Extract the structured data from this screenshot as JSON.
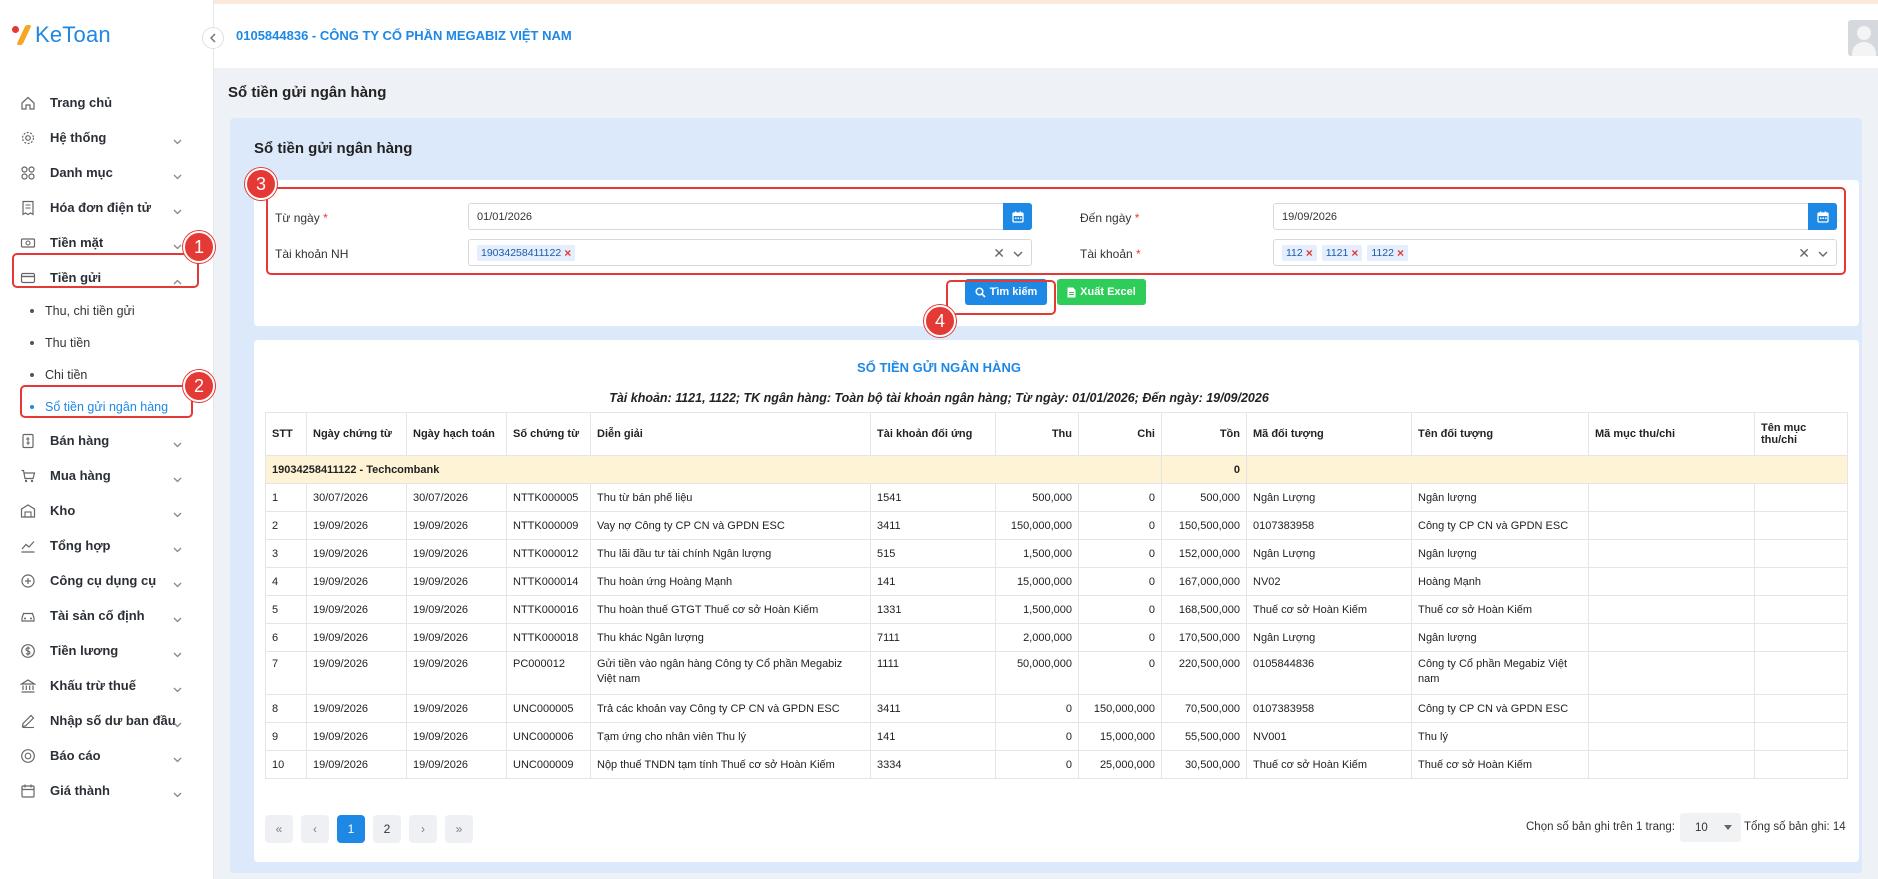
{
  "brand": {
    "logo_text": "KeToan"
  },
  "header": {
    "company": "0105844836 - CÔNG TY CỔ PHẦN MEGABIZ VIỆT NAM"
  },
  "sidebar": {
    "items": [
      {
        "label": "Trang chủ",
        "icon": "home-icon"
      },
      {
        "label": "Hệ thống",
        "icon": "gear-icon"
      },
      {
        "label": "Danh mục",
        "icon": "grid-icon"
      },
      {
        "label": "Hóa đơn điện tử",
        "icon": "invoice-icon"
      },
      {
        "label": "Tiền mặt",
        "icon": "cash-icon"
      },
      {
        "label": "Tiền gửi",
        "icon": "card-icon"
      },
      {
        "label": "Bán hàng",
        "icon": "sales-icon"
      },
      {
        "label": "Mua hàng",
        "icon": "cart-icon"
      },
      {
        "label": "Kho",
        "icon": "warehouse-icon"
      },
      {
        "label": "Tổng hợp",
        "icon": "chart-icon"
      },
      {
        "label": "Công cụ dụng cụ",
        "icon": "tools-icon"
      },
      {
        "label": "Tài sản cố định",
        "icon": "car-icon"
      },
      {
        "label": "Tiền lương",
        "icon": "dollar-icon"
      },
      {
        "label": "Khấu trừ thuế",
        "icon": "bank-icon"
      },
      {
        "label": "Nhập số dư ban đầu",
        "icon": "edit-icon"
      },
      {
        "label": "Báo cáo",
        "icon": "report-icon"
      },
      {
        "label": "Giá thành",
        "icon": "calendar-icon"
      }
    ],
    "sub_items": [
      {
        "label": "Thu, chi tiền gửi"
      },
      {
        "label": "Thu tiền"
      },
      {
        "label": "Chi tiền"
      },
      {
        "label": "Sổ tiền gửi ngân hàng"
      }
    ]
  },
  "page": {
    "title": "Sổ tiền gửi ngân hàng",
    "panel_title": "Sổ tiền gửi ngân hàng"
  },
  "filters": {
    "from_date_label": "Từ ngày",
    "from_date": "01/01/2026",
    "to_date_label": "Đến ngày",
    "to_date": "19/09/2026",
    "bank_account_label": "Tài khoản NH",
    "bank_account_tag": "19034258411122",
    "account_label": "Tài khoản",
    "account_tags": [
      "112",
      "1121",
      "1122"
    ],
    "required_mark": "*",
    "search_label": "Tìm kiếm",
    "excel_label": "Xuất Excel"
  },
  "report": {
    "title": "SỔ TIỀN GỬI NGÂN HÀNG",
    "subtitle": "Tài khoản: 1121, 1122; TK ngân hàng: Toàn bộ tài khoản ngân hàng; Từ ngày: 01/01/2026; Đến ngày: 19/09/2026"
  },
  "table": {
    "headers": [
      "STT",
      "Ngày chứng từ",
      "Ngày hạch toán",
      "Số chứng từ",
      "Diễn giải",
      "Tài khoản đối ứng",
      "Thu",
      "Chi",
      "Tồn",
      "Mã đối tượng",
      "Tên đối tượng",
      "Mã mục thu/chi",
      "Tên mục thu/chi"
    ],
    "group": {
      "label": "19034258411122 - Techcombank",
      "balance": "0"
    },
    "rows": [
      [
        "1",
        "30/07/2026",
        "30/07/2026",
        "NTTK000005",
        "Thu từ bán phế liệu",
        "1541",
        "500,000",
        "0",
        "500,000",
        "Ngân Lượng",
        "Ngân lượng",
        "",
        ""
      ],
      [
        "2",
        "19/09/2026",
        "19/09/2026",
        "NTTK000009",
        "Vay nợ Công ty CP CN và GPDN ESC",
        "3411",
        "150,000,000",
        "0",
        "150,500,000",
        "0107383958",
        "Công ty CP CN và GPDN ESC",
        "",
        ""
      ],
      [
        "3",
        "19/09/2026",
        "19/09/2026",
        "NTTK000012",
        "Thu lãi đầu tư tài chính Ngân lượng",
        "515",
        "1,500,000",
        "0",
        "152,000,000",
        "Ngân Lượng",
        "Ngân lượng",
        "",
        ""
      ],
      [
        "4",
        "19/09/2026",
        "19/09/2026",
        "NTTK000014",
        "Thu hoàn ứng Hoàng Mạnh",
        "141",
        "15,000,000",
        "0",
        "167,000,000",
        "NV02",
        "Hoàng Mạnh",
        "",
        ""
      ],
      [
        "5",
        "19/09/2026",
        "19/09/2026",
        "NTTK000016",
        "Thu hoàn thuế GTGT Thuế cơ sở Hoàn Kiếm",
        "1331",
        "1,500,000",
        "0",
        "168,500,000",
        "Thuế cơ sở Hoàn Kiếm",
        "Thuế cơ sở Hoàn Kiếm",
        "",
        ""
      ],
      [
        "6",
        "19/09/2026",
        "19/09/2026",
        "NTTK000018",
        "Thu khác Ngân lượng",
        "7111",
        "2,000,000",
        "0",
        "170,500,000",
        "Ngân Lượng",
        "Ngân lượng",
        "",
        ""
      ],
      [
        "7",
        "19/09/2026",
        "19/09/2026",
        "PC000012",
        "Gửi tiền vào ngân hàng Công ty Cổ phần Megabiz Việt nam",
        "1111",
        "50,000,000",
        "0",
        "220,500,000",
        "0105844836",
        "Công ty Cổ phần Megabiz Việt nam",
        "",
        ""
      ],
      [
        "8",
        "19/09/2026",
        "19/09/2026",
        "UNC000005",
        "Trả các khoản vay Công ty CP CN và GPDN ESC",
        "3411",
        "0",
        "150,000,000",
        "70,500,000",
        "0107383958",
        "Công ty CP CN và GPDN ESC",
        "",
        ""
      ],
      [
        "9",
        "19/09/2026",
        "19/09/2026",
        "UNC000006",
        "Tạm ứng cho nhân viên Thu lý",
        "141",
        "0",
        "15,000,000",
        "55,500,000",
        "NV001",
        "Thu lý",
        "",
        ""
      ],
      [
        "10",
        "19/09/2026",
        "19/09/2026",
        "UNC000009",
        "Nộp thuế TNDN tạm tính Thuế cơ sở Hoàn Kiếm",
        "3334",
        "0",
        "25,000,000",
        "30,500,000",
        "Thuế cơ sở Hoàn Kiếm",
        "Thuế cơ sở Hoàn Kiếm",
        "",
        ""
      ]
    ]
  },
  "pagination": {
    "first": "«",
    "prev": "‹",
    "next": "›",
    "last": "»",
    "pages": [
      "1",
      "2"
    ],
    "current": "1",
    "page_size_label": "Chọn số bản ghi trên 1 trang:",
    "page_size": "10",
    "total_label": "Tổng số bản ghi: 14"
  },
  "annotations": [
    "1",
    "2",
    "3",
    "4"
  ],
  "colors": {
    "accent": "#1e88e5",
    "excel": "#2ecc58",
    "annotation": "#e53935",
    "group_row": "#fff3d6"
  }
}
